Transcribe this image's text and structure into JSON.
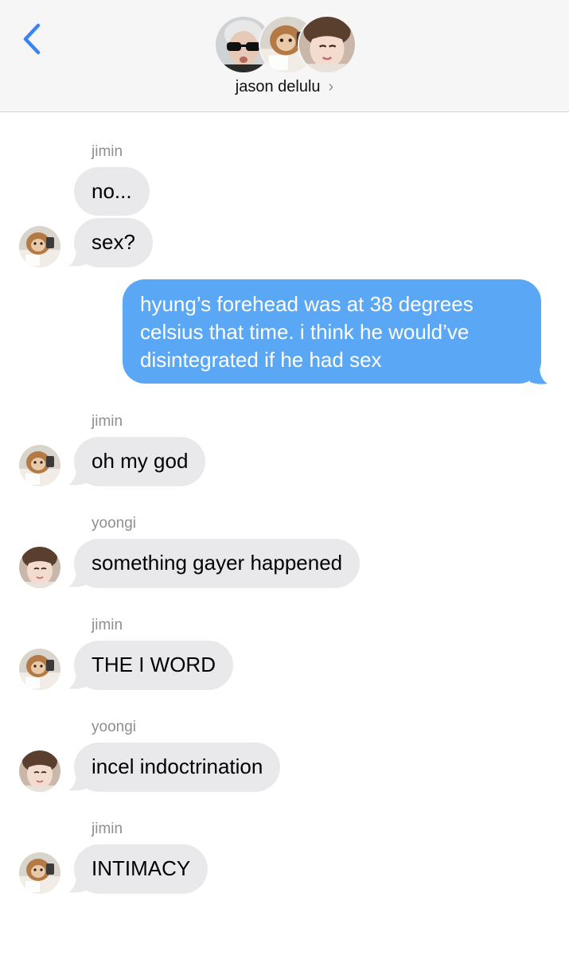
{
  "header": {
    "title": "jason delulu",
    "chevron": "›",
    "back_icon": "chevron-left-icon",
    "accent_color": "#3b82f6"
  },
  "colors": {
    "incoming_bubble": "#e9e9eb",
    "outgoing_bubble": "#5aa7f5",
    "sender_label": "#8e8e93"
  },
  "messages": [
    {
      "type": "sender",
      "text": "jimin"
    },
    {
      "type": "incoming",
      "text": "no..."
    },
    {
      "type": "incoming",
      "text": "sex?",
      "avatar": "jimin"
    },
    {
      "type": "outgoing",
      "text": "hyung’s forehead was at 38 degrees celsius that time. i think he would’ve disintegrated if he had sex"
    },
    {
      "type": "sender",
      "text": "jimin"
    },
    {
      "type": "incoming",
      "text": "oh my god",
      "avatar": "jimin"
    },
    {
      "type": "sender",
      "text": "yoongi"
    },
    {
      "type": "incoming",
      "text": "something gayer happened",
      "avatar": "yoongi"
    },
    {
      "type": "sender",
      "text": "jimin"
    },
    {
      "type": "incoming",
      "text": "THE I WORD",
      "avatar": "jimin"
    },
    {
      "type": "sender",
      "text": "yoongi"
    },
    {
      "type": "incoming",
      "text": "incel indoctrination",
      "avatar": "yoongi"
    },
    {
      "type": "sender",
      "text": "jimin"
    },
    {
      "type": "incoming",
      "text": "INTIMACY",
      "avatar": "jimin"
    }
  ]
}
